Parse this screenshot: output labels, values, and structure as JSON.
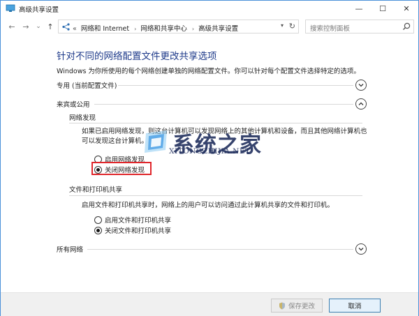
{
  "window": {
    "title": "高级共享设置",
    "buttons": {
      "minimize": "—",
      "maximize": "☐",
      "close": "✕"
    }
  },
  "nav": {
    "back": "←",
    "forward": "→",
    "recent": "⌄",
    "up": "↑",
    "overflow": "«",
    "breadcrumbs": [
      "网络和 Internet",
      "网络和共享中心",
      "高级共享设置"
    ],
    "separator": "›",
    "search_placeholder": "搜索控制面板"
  },
  "main": {
    "heading": "针对不同的网络配置文件更改共享选项",
    "description": "Windows 为你所使用的每个网络创建单独的网络配置文件。你可以针对每个配置文件选择特定的选项。",
    "profiles": [
      {
        "label": "专用 (当前配置文件)",
        "expanded": false
      },
      {
        "label": "来宾或公用",
        "expanded": true
      },
      {
        "label": "所有网络",
        "expanded": false
      }
    ],
    "network_discovery": {
      "title": "网络发现",
      "text_line1": "如果已启用网络发现，则这台计算机可以发现网络上的其他计算机和设备，而且其他网络计算机也",
      "text_line2": "可以发现这台计算机。",
      "options": [
        "启用网络发现",
        "关闭网络发现"
      ],
      "selected": 1
    },
    "file_printer_sharing": {
      "title": "文件和打印机共享",
      "text": "启用文件和打印机共享时，网络上的用户可以访问通过此计算机共享的文件和打印机。",
      "options": [
        "启用文件和打印机共享",
        "关闭文件和打印机共享"
      ],
      "selected": 1
    }
  },
  "watermark": {
    "main": "系统之家",
    "sub": "XITONGZHIJIA.NET"
  },
  "footer": {
    "save": "保存更改",
    "cancel": "取消"
  },
  "colors": {
    "heading": "#1e3a8a",
    "highlight_border": "#e0262b",
    "window_border": "#4a90d9"
  }
}
